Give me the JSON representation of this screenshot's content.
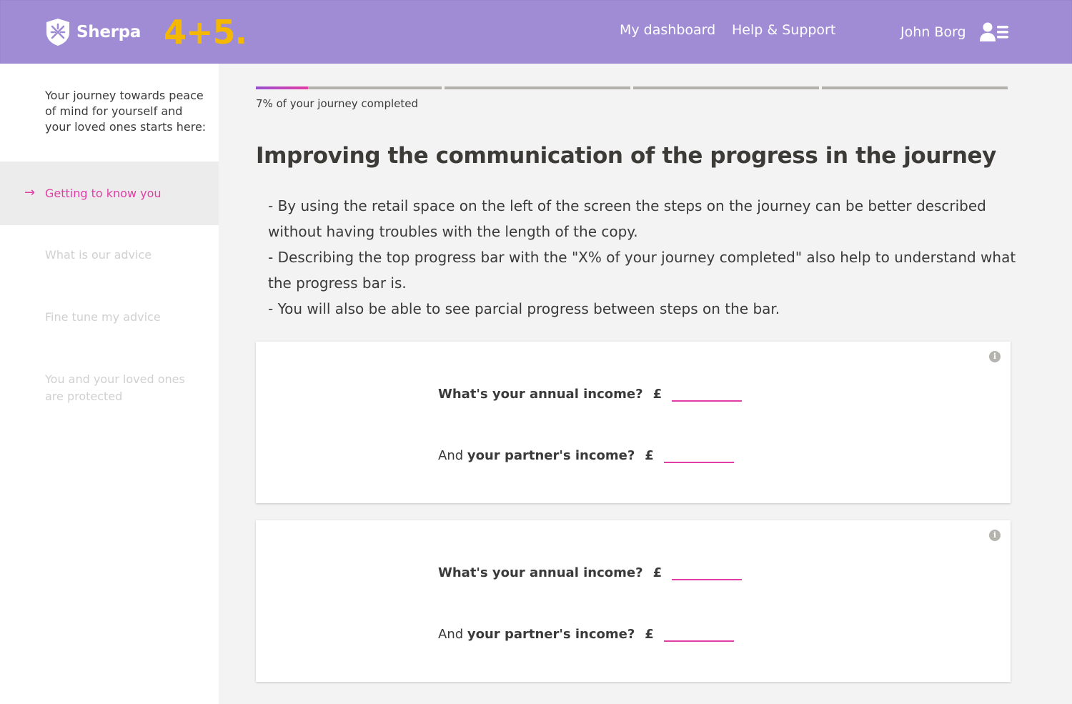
{
  "header": {
    "brand": "Sherpa",
    "badge": "4+5.",
    "nav": {
      "dashboard": "My dashboard",
      "help": "Help & Support"
    },
    "user": {
      "name": "John Borg"
    },
    "colors": {
      "bar": "#a08cd4",
      "badge": "#f5b800"
    }
  },
  "sidebar": {
    "intro": "Your journey towards peace of mind for yourself and your loved ones starts here:",
    "active_step": "Getting to know you",
    "steps": [
      "What is our advice",
      "Fine tune my advice",
      "You and your loved ones are protected"
    ]
  },
  "progress": {
    "percent_completed": 7,
    "segments": 4,
    "label": "7% of your journey completed",
    "accent": "#e23da6"
  },
  "main": {
    "title": "Improving the communication of the progress in the journey",
    "bullets": [
      "-  By using the retail space on the left of the screen the steps on the journey can be better described without having troubles with the length of the copy.",
      "-  Describing the top progress bar with the \"X% of your journey completed\" also help to understand what the progress bar is.",
      "-  You will also be able to see parcial progress between steps on the bar."
    ]
  },
  "cards": [
    {
      "info": "i",
      "q1": {
        "label": "What's your annual income?",
        "currency": "£",
        "value": ""
      },
      "q2": {
        "prefix": "And",
        "label": "your partner's income?",
        "currency": "£",
        "value": ""
      }
    },
    {
      "info": "i",
      "q1": {
        "label": "What's your annual income?",
        "currency": "£",
        "value": ""
      },
      "q2": {
        "prefix": "And",
        "label": "your partner's income?",
        "currency": "£",
        "value": ""
      }
    }
  ]
}
